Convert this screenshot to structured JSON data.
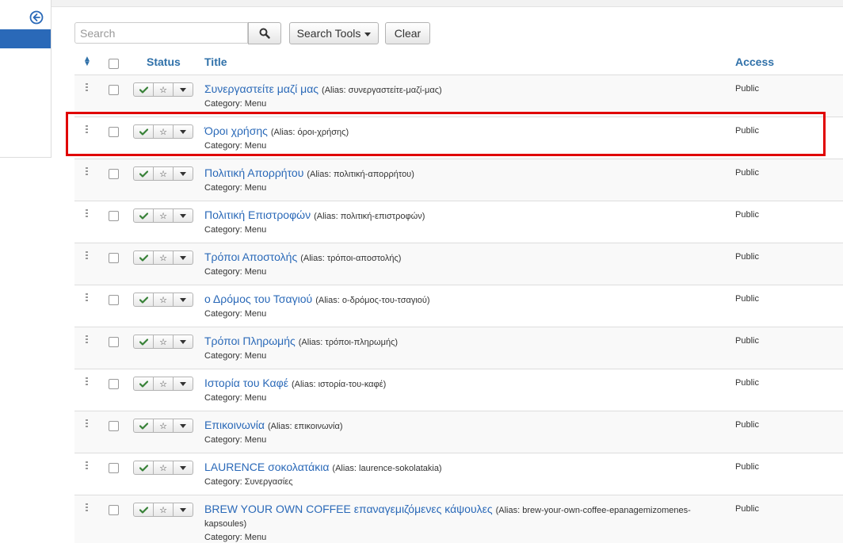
{
  "toolbar": {
    "search_placeholder": "Search",
    "search_tools_label": "Search Tools",
    "clear_label": "Clear"
  },
  "table": {
    "headers": {
      "status": "Status",
      "title": "Title",
      "access": "Access"
    },
    "rows": [
      {
        "title": "Συνεργαστείτε μαζί μας",
        "alias": "(Alias: συνεργαστείτε-μαζί-μας)",
        "category": "Category: Menu",
        "access": "Public"
      },
      {
        "title": "Όροι χρήσης",
        "alias": "(Alias: όροι-χρήσης)",
        "category": "Category: Menu",
        "access": "Public"
      },
      {
        "title": "Πολιτική Απορρήτου",
        "alias": "(Alias: πολιτική-απορρήτου)",
        "category": "Category: Menu",
        "access": "Public"
      },
      {
        "title": "Πολιτική Επιστροφών",
        "alias": "(Alias: πολιτική-επιστροφών)",
        "category": "Category: Menu",
        "access": "Public"
      },
      {
        "title": "Τρόποι Αποστολής",
        "alias": "(Alias: τρόποι-αποστολής)",
        "category": "Category: Menu",
        "access": "Public"
      },
      {
        "title": "ο Δρόμος του Τσαγιού",
        "alias": "(Alias: ο-δρόμος-του-τσαγιού)",
        "category": "Category: Menu",
        "access": "Public"
      },
      {
        "title": "Τρόποι Πληρωμής",
        "alias": "(Alias: τρόποι-πληρωμής)",
        "category": "Category: Menu",
        "access": "Public"
      },
      {
        "title": "Ιστορία του Καφέ",
        "alias": "(Alias: ιστορία-του-καφέ)",
        "category": "Category: Menu",
        "access": "Public"
      },
      {
        "title": "Επικοινωνία",
        "alias": "(Alias: επικοινωνία)",
        "category": "Category: Menu",
        "access": "Public"
      },
      {
        "title": "LAURENCE σοκολατάκια",
        "alias": "(Alias: laurence-sokolatakia)",
        "category": "Category: Συνεργασίες",
        "access": "Public"
      },
      {
        "title": "BREW YOUR OWN COFFEE επαναγεμιζόμενες κάψουλες",
        "alias": "(Alias: brew-your-own-coffee-epanagemizomenes-kapsoules)",
        "category": "Category: Menu",
        "access": "Public"
      }
    ]
  },
  "colors": {
    "accent": "#2a69b8",
    "published": "#378137",
    "highlight": "#e00000"
  }
}
